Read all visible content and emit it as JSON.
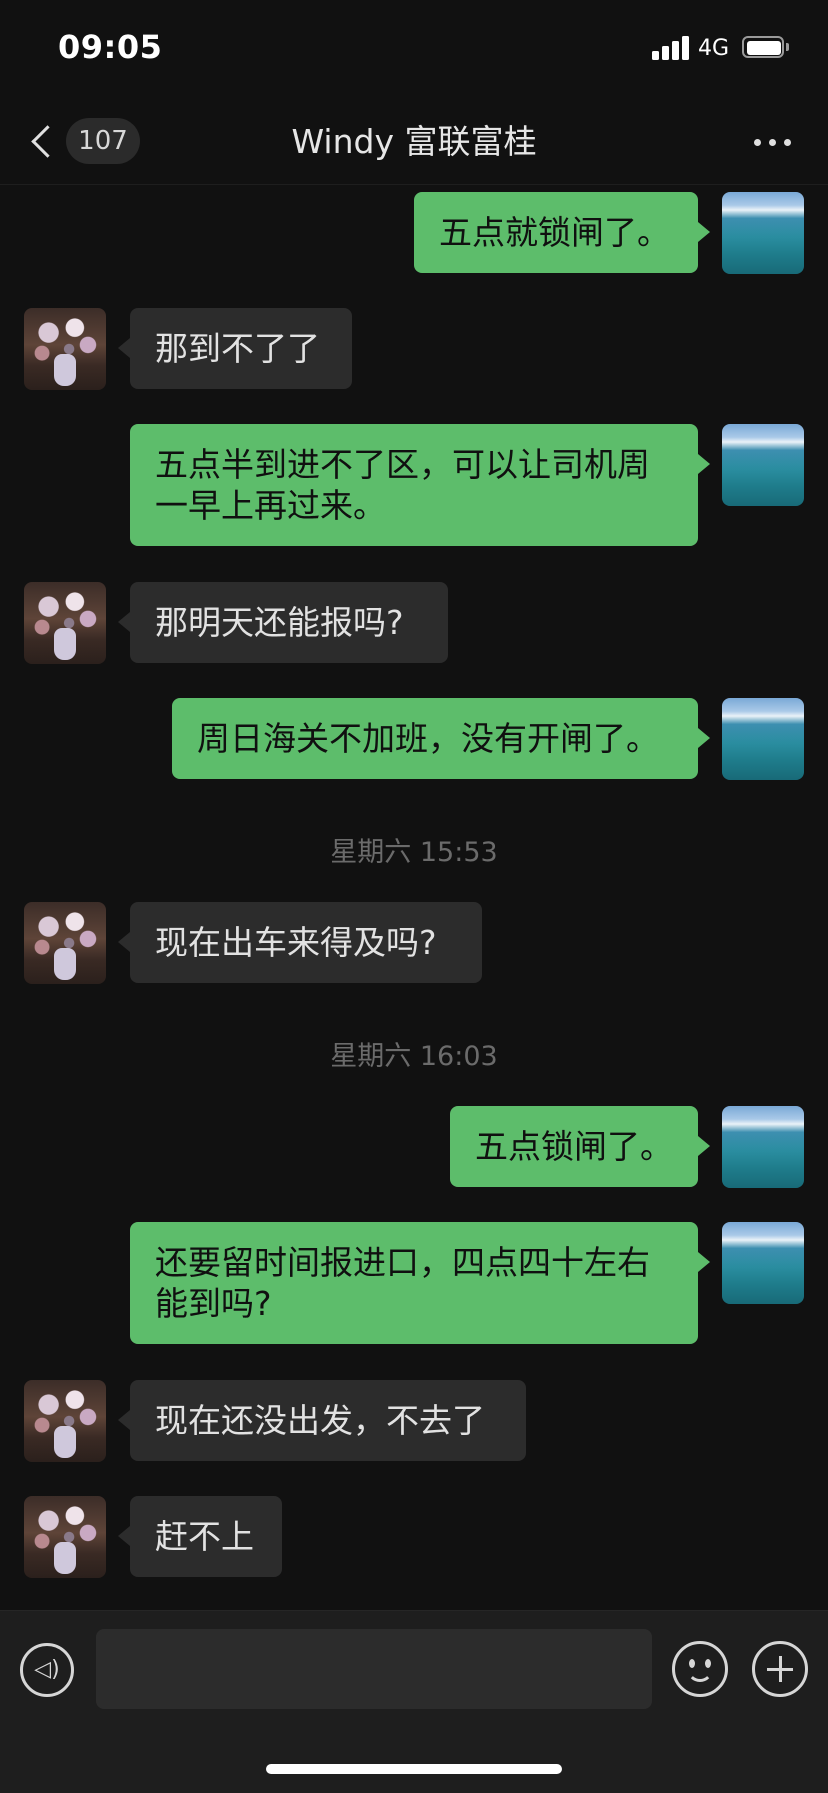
{
  "status_bar": {
    "time": "09:05",
    "network": "4G"
  },
  "nav": {
    "unread_count": "107",
    "title": "Windy 富联富桂"
  },
  "messages": [
    {
      "sender": "me",
      "text": "五点就锁闸了。"
    },
    {
      "sender": "other",
      "text": "那到不了了"
    },
    {
      "sender": "me",
      "text": "五点半到进不了区，可以让司机周一早上再过来。"
    },
    {
      "sender": "other",
      "text": "那明天还能报吗?"
    },
    {
      "sender": "me",
      "text": "周日海关不加班，没有开闸了。"
    },
    {
      "sender": "time",
      "text": "星期六 15:53"
    },
    {
      "sender": "other",
      "text": "现在出车来得及吗?"
    },
    {
      "sender": "time",
      "text": "星期六 16:03"
    },
    {
      "sender": "me",
      "text": "五点锁闸了。"
    },
    {
      "sender": "me",
      "text": "还要留时间报进口，四点四十左右能到吗?"
    },
    {
      "sender": "other",
      "text": "现在还没出发，不去了"
    },
    {
      "sender": "other",
      "text": "赶不上"
    }
  ],
  "input": {
    "value": "",
    "placeholder": ""
  },
  "icons": {
    "back": "back-chevron-icon",
    "more": "more-dots-icon",
    "voice": "voice-icon",
    "emoji": "emoji-icon",
    "plus": "plus-icon"
  },
  "colors": {
    "background": "#111111",
    "my_bubble": "#5dbd6b",
    "other_bubble": "#2c2c2c",
    "timestamp": "#6b6b6b"
  }
}
